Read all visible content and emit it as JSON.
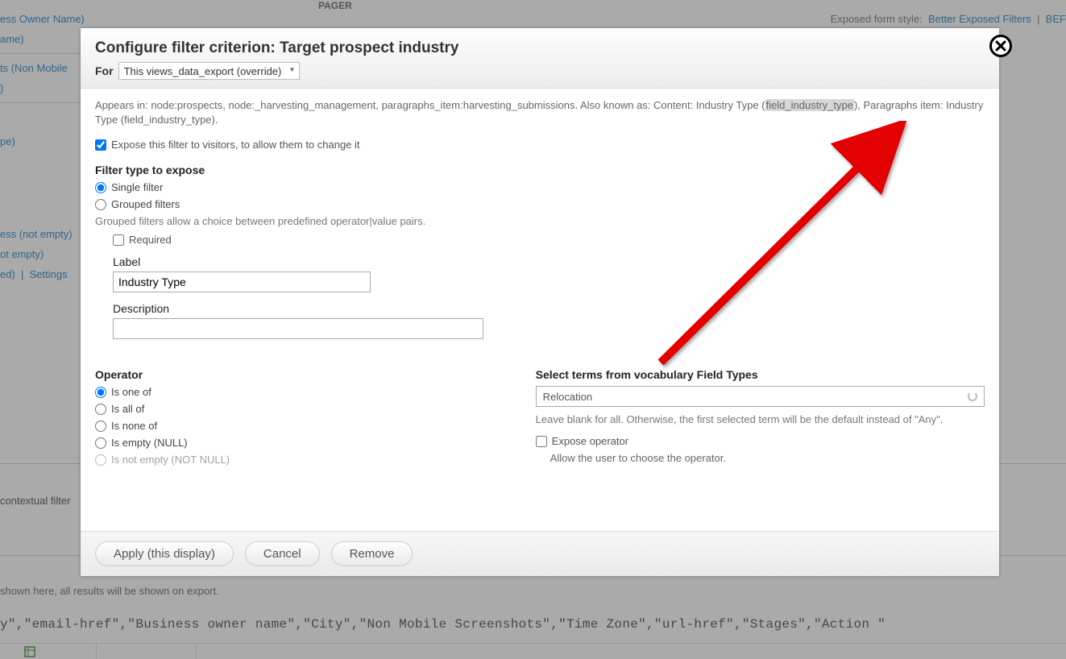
{
  "bg": {
    "pager": "PAGER",
    "exposed_prefix": "Exposed form style:",
    "exposed_link1": "Better Exposed Filters",
    "exposed_link2": "BEF",
    "sidebar": {
      "i0": "ess Owner Name)",
      "i1": "ame)",
      "i2": "ts (Non Mobile",
      "i3": ")",
      "i4": "pe)",
      "i5": "ess (not empty)",
      "i6": "ot empty)",
      "i7a": "ed)",
      "i7b": "Settings"
    },
    "ctx": "contextual filter",
    "hint": "shown here, all results will be shown on export.",
    "fields": "y\",\"email-href\",\"Business owner name\",\"City\",\"Non Mobile Screenshots\",\"Time Zone\",\"url-href\",\"Stages\",\"Action \""
  },
  "modal": {
    "title": "Configure filter criterion: Target prospect industry",
    "for_label": "For",
    "for_select": "This views_data_export (override)",
    "appears_a": "Appears in: node:prospects, node:_harvesting_management, paragraphs_item:harvesting_submissions. Also known as: Content: Industry Type (",
    "appears_hl": "field_industry_type",
    "appears_b": "), Paragraphs item: Industry Type (field_industry_type).",
    "expose_label": "Expose this filter to visitors, to allow them to change it",
    "filter_type_title": "Filter type to expose",
    "r_single": "Single filter",
    "r_grouped": "Grouped filters",
    "grouped_desc": "Grouped filters allow a choice between predefined operator|value pairs.",
    "required_label": "Required",
    "label_label": "Label",
    "label_value": "Industry Type",
    "desc_label": "Description",
    "desc_value": "",
    "operator_title": "Operator",
    "op_isoneof": "Is one of",
    "op_isallof": "Is all of",
    "op_isnoneof": "Is none of",
    "op_isempty": "Is empty (NULL)",
    "op_isnotempty": "Is not empty (NOT NULL)",
    "vocab_title": "Select terms from vocabulary Field Types",
    "vocab_value": "Relocation",
    "vocab_hint": "Leave blank for all. Otherwise, the first selected term will be the default instead of \"Any\".",
    "expose_op_label": "Expose operator",
    "expose_op_hint": "Allow the user to choose the operator."
  },
  "footer": {
    "apply": "Apply (this display)",
    "cancel": "Cancel",
    "remove": "Remove"
  }
}
